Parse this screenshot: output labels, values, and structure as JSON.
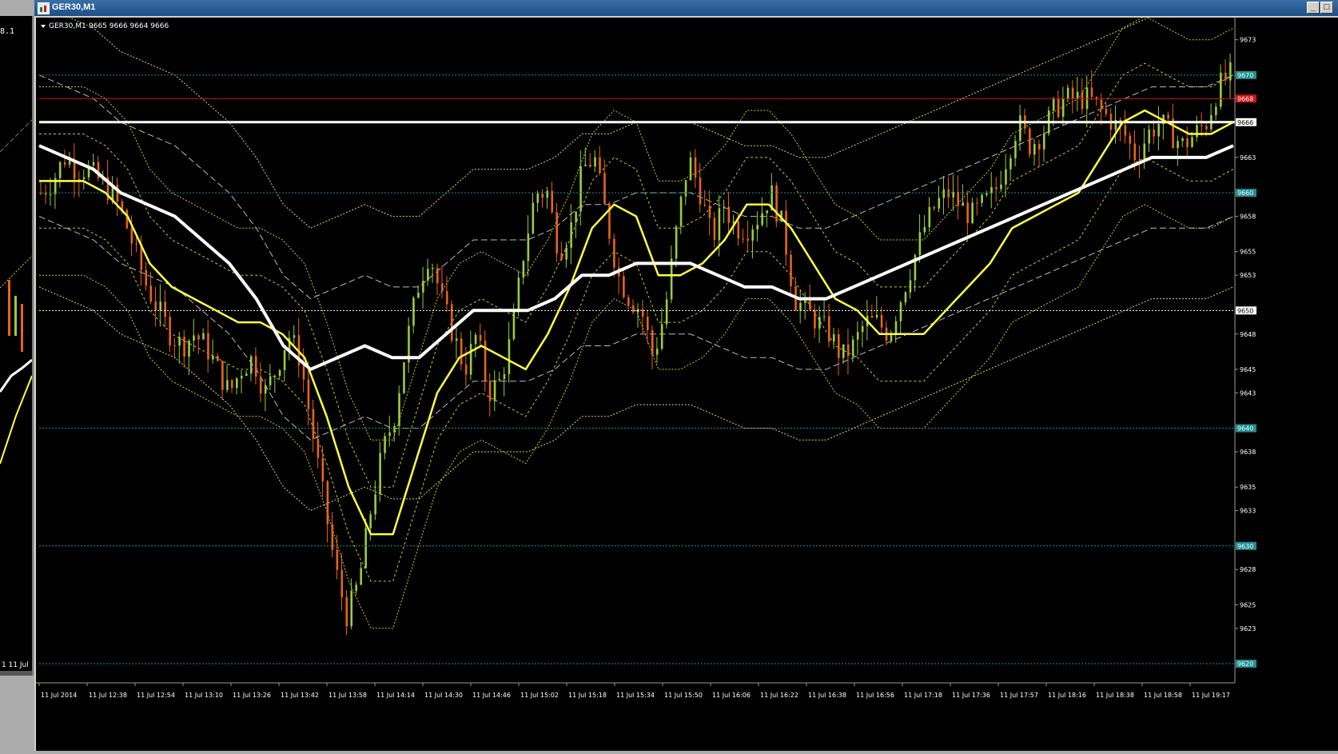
{
  "left_window": {
    "top_label": "8.1",
    "bottom_label": "1  11 Jul"
  },
  "window": {
    "title": "GER30,M1"
  },
  "chart_header": {
    "symbol_label": "GER30,M1",
    "ohlc": "9665 9666 9664 9666"
  },
  "chart_data": {
    "type": "candlestick",
    "symbol": "GER30",
    "timeframe": "M1",
    "price_axis": {
      "min": 9620,
      "max": 9674,
      "ticks": [
        9673,
        9670,
        9668,
        9666,
        9663,
        9660,
        9658,
        9655,
        9653,
        9650,
        9648,
        9645,
        9643,
        9640,
        9638,
        9635,
        9633,
        9630,
        9628,
        9625,
        9623,
        9620
      ]
    },
    "highlighted_levels": [
      {
        "price": 9670,
        "label": "9670",
        "color": "#1f8f8f"
      },
      {
        "price": 9668,
        "label": "9668",
        "color": "#c81414"
      },
      {
        "price": 9666,
        "label": "9666",
        "color": "#ffffff"
      },
      {
        "price": 9660,
        "label": "9660",
        "color": "#1f8f8f"
      },
      {
        "price": 9650,
        "label": "9650",
        "color": "#ffffff"
      },
      {
        "price": 9640,
        "label": "9640",
        "color": "#1f8f8f"
      },
      {
        "price": 9630,
        "label": "9630",
        "color": "#1f8f8f"
      },
      {
        "price": 9620,
        "label": "9620",
        "color": "#1f8f8f"
      }
    ],
    "time_labels": [
      "11 Jul 2014",
      "11 Jul 12:38",
      "11 Jul 12:54",
      "11 Jul 13:10",
      "11 Jul 13:26",
      "11 Jul 13:42",
      "11 Jul 13:58",
      "11 Jul 14:14",
      "11 Jul 14:30",
      "11 Jul 14:46",
      "11 Jul 15:02",
      "11 Jul 15:18",
      "11 Jul 15:34",
      "11 Jul 15:50",
      "11 Jul 16:06",
      "11 Jul 16:22",
      "11 Jul 16:38",
      "11 Jul 16:56",
      "11 Jul 17:18",
      "11 Jul 17:36",
      "11 Jul 17:57",
      "11 Jul 18:16",
      "11 Jul 18:38",
      "11 Jul 18:58",
      "11 Jul 19:17"
    ],
    "close_path": [
      9660,
      9661,
      9663,
      9662,
      9662,
      9661,
      9660,
      9658,
      9655,
      9652,
      9650,
      9648,
      9647,
      9648,
      9647,
      9645,
      9643,
      9645,
      9646,
      9643,
      9645,
      9648,
      9646,
      9640,
      9634,
      9628,
      9624,
      9627,
      9633,
      9638,
      9641,
      9647,
      9652,
      9655,
      9651,
      9648,
      9645,
      9648,
      9643,
      9644,
      9648,
      9655,
      9660,
      9660,
      9655,
      9657,
      9662,
      9663,
      9658,
      9653,
      9651,
      9650,
      9646,
      9650,
      9657,
      9663,
      9660,
      9656,
      9659,
      9657,
      9657,
      9658,
      9660,
      9657,
      9651,
      9650,
      9649,
      9648,
      9646,
      9647,
      9649,
      9649,
      9648,
      9651,
      9654,
      9657,
      9659,
      9660,
      9659,
      9658,
      9659,
      9660,
      9663,
      9666,
      9664,
      9665,
      9667,
      9668,
      9668,
      9668,
      9667,
      9666,
      9665,
      9663,
      9665,
      9666,
      9665,
      9664,
      9665,
      9666,
      9669,
      9670
    ],
    "moving_averages": [
      {
        "color": "#ffff40",
        "values": [
          9661,
          9661,
          9661,
          9660,
          9658,
          9654,
          9652,
          9651,
          9650,
          9649,
          9649,
          9648,
          9646,
          9641,
          9635,
          9631,
          9631,
          9637,
          9643,
          9646,
          9647,
          9646,
          9645,
          9648,
          9652,
          9657,
          9659,
          9658,
          9653,
          9653,
          9654,
          9656,
          9659,
          9659,
          9657,
          9654,
          9651,
          9650,
          9648,
          9648,
          9648,
          9650,
          9652,
          9654,
          9657,
          9658,
          9659,
          9660,
          9663,
          9666,
          9667,
          9666,
          9665,
          9665,
          9666
        ]
      },
      {
        "color": "#ffffff",
        "values": [
          9664,
          9663,
          9662,
          9660,
          9659,
          9658,
          9656,
          9654,
          9651,
          9647,
          9645,
          9646,
          9647,
          9646,
          9646,
          9648,
          9650,
          9650,
          9650,
          9651,
          9653,
          9653,
          9654,
          9654,
          9654,
          9653,
          9652,
          9652,
          9651,
          9651,
          9652,
          9653,
          9654,
          9655,
          9656,
          9657,
          9658,
          9659,
          9660,
          9661,
          9662,
          9663,
          9663,
          9663,
          9664
        ]
      }
    ]
  }
}
